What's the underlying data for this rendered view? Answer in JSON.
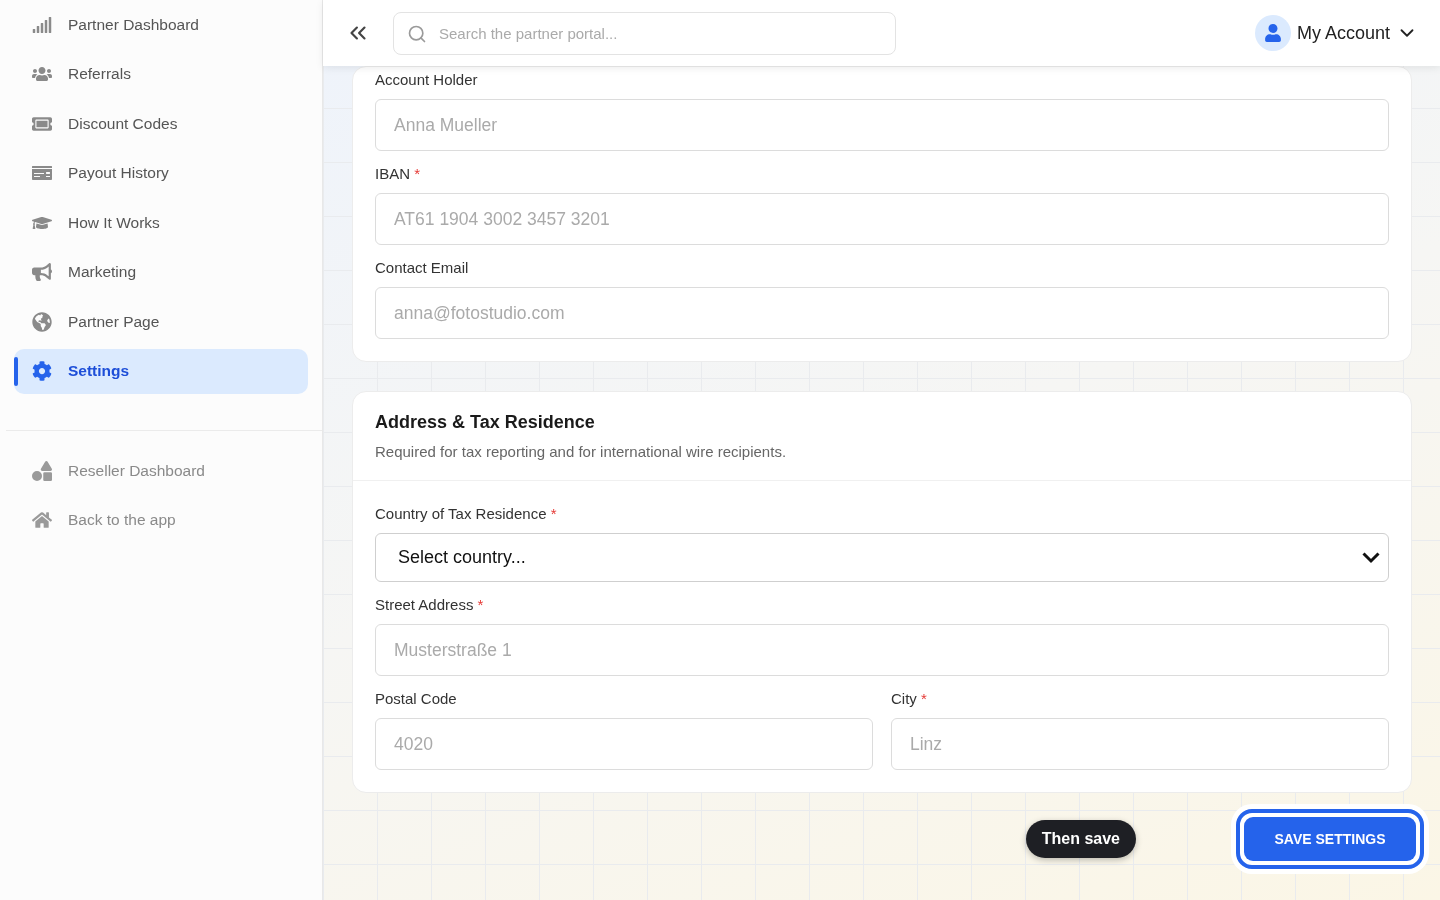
{
  "sidebar": {
    "items": [
      {
        "label": "Partner Dashboard",
        "selected": false
      },
      {
        "label": "Referrals",
        "selected": false
      },
      {
        "label": "Discount Codes",
        "selected": false
      },
      {
        "label": "Payout History",
        "selected": false
      },
      {
        "label": "How It Works",
        "selected": false
      },
      {
        "label": "Marketing",
        "selected": false
      },
      {
        "label": "Partner Page",
        "selected": false
      },
      {
        "label": "Settings",
        "selected": true
      }
    ],
    "secondary_items": [
      {
        "label": "Reseller Dashboard"
      },
      {
        "label": "Back to the app"
      }
    ]
  },
  "header": {
    "search": {
      "placeholder": "Search the partner portal..."
    },
    "account": "My Account"
  },
  "payout_card": {
    "rows": [
      [
        {
          "kind": "input",
          "label": "Account Holder",
          "placeholder": "Anna Mueller"
        }
      ],
      [
        {
          "kind": "input",
          "label": "IBAN",
          "required_mark": "*",
          "placeholder": "AT61 1904 3002 3457 3201"
        }
      ],
      [
        {
          "kind": "input",
          "label": "Contact Email",
          "placeholder": "anna@fotostudio.com"
        }
      ]
    ]
  },
  "address_card": {
    "title": "Address & Tax Residence",
    "subtitle": "Required for tax reporting and for international wire recipients.",
    "rows": [
      [
        {
          "kind": "select",
          "label": "Country of Tax Residence",
          "required_mark": "*",
          "value": "Select country..."
        }
      ],
      [
        {
          "kind": "input",
          "label": "Street Address",
          "required_mark": "*",
          "placeholder": "Musterstraße 1"
        }
      ],
      [
        {
          "kind": "input",
          "label": "Postal Code",
          "placeholder": "4020"
        },
        {
          "kind": "input",
          "label": "City",
          "required_mark": "*",
          "placeholder": "Linz"
        }
      ]
    ]
  },
  "tooltip": "Then save",
  "save_button": "SAVE SETTINGS"
}
